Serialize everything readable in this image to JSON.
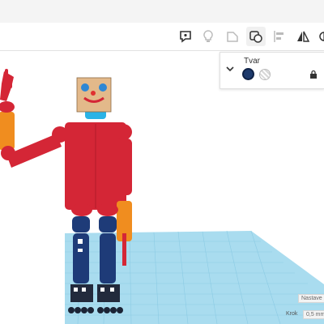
{
  "inspector": {
    "title": "Tvar",
    "solid_color": "#1d3a6c",
    "swatches": [
      "solid-color",
      "hole-pattern"
    ]
  },
  "toolbar": {
    "icons": [
      "note-icon",
      "lightbulb-icon",
      "shape-icon",
      "group-icon",
      "align-icon",
      "mirror-icon",
      "more-icon"
    ]
  },
  "footer": {
    "settings_label": "Nastave",
    "step_label": "Krok",
    "step_value": "0,5 mm"
  },
  "colors": {
    "robot_red": "#d42636",
    "arm_orange": "#f08d1f",
    "leg_navy": "#1e3b78",
    "face_tan": "#e3b98a",
    "grid_blue": "#a9dcef"
  }
}
